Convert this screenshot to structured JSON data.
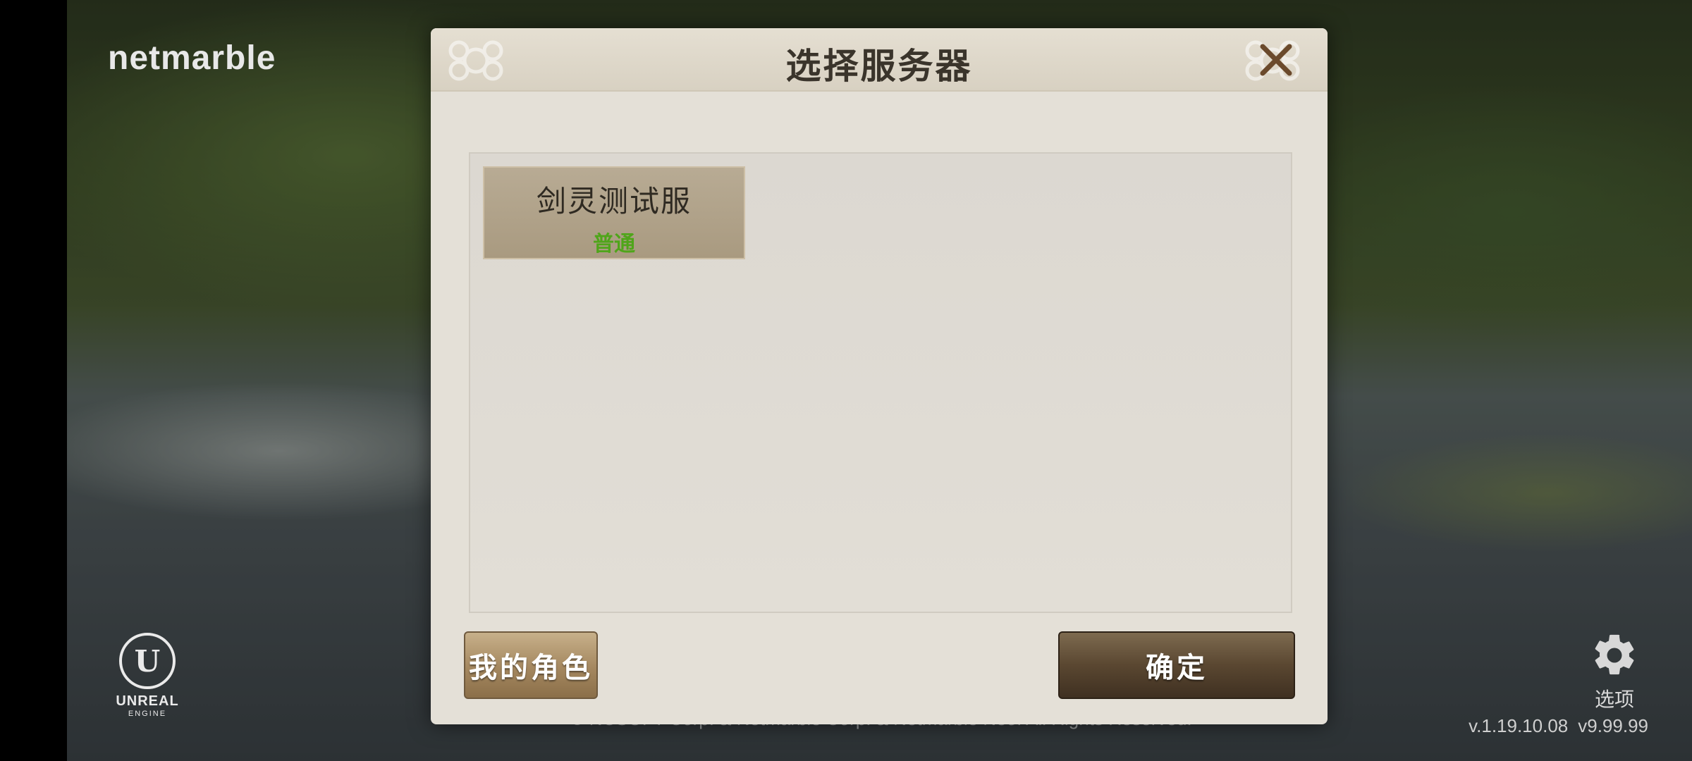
{
  "brand": {
    "publisher": "netmarble",
    "engine_line1": "UNREAL",
    "engine_line2": "ENGINE",
    "engine_mark": "U"
  },
  "dialog": {
    "title": "选择服务器",
    "close_icon": "close-icon",
    "servers": [
      {
        "name": "剑灵测试服",
        "status": "普通",
        "status_color": "#4fa51a"
      }
    ],
    "my_characters_label": "我的角色",
    "confirm_label": "确定"
  },
  "footer": {
    "options_label": "选项",
    "options_icon": "gear-icon",
    "version_client": "v.1.19.10.08",
    "version_resource": "v9.99.99",
    "copyright": "© NCSOFT Corp. & Netmarble Corp. & Netmarble Neo. All Rights Reserved."
  },
  "colors": {
    "dialog_bg": "#e4e0d7",
    "title_text": "#3a342b",
    "accent_green": "#4fa51a",
    "button_dark": "#4a3a27"
  }
}
